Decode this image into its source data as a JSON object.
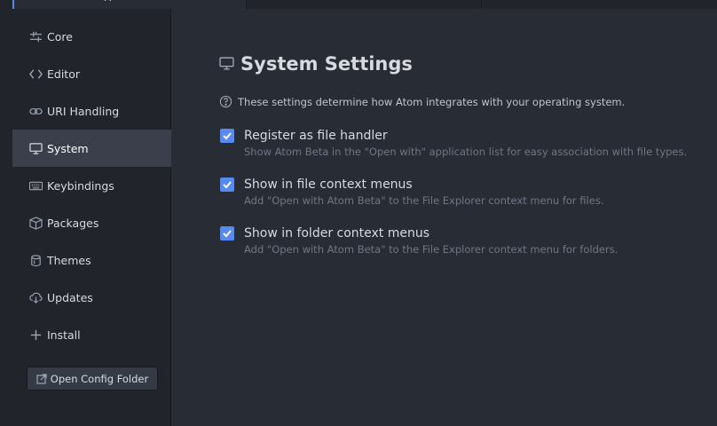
{
  "sidebar": {
    "items": [
      {
        "label": "Core",
        "icon": "sliders-icon"
      },
      {
        "label": "Editor",
        "icon": "code-icon"
      },
      {
        "label": "URI Handling",
        "icon": "link-icon"
      },
      {
        "label": "System",
        "icon": "monitor-icon",
        "selected": true
      },
      {
        "label": "Keybindings",
        "icon": "keyboard-icon"
      },
      {
        "label": "Packages",
        "icon": "package-icon"
      },
      {
        "label": "Themes",
        "icon": "paintcan-icon"
      },
      {
        "label": "Updates",
        "icon": "cloud-download-icon"
      },
      {
        "label": "Install",
        "icon": "plus-icon"
      }
    ],
    "config_button": "Open Config Folder"
  },
  "main": {
    "title": "System Settings",
    "description": "These settings determine how Atom integrates with your operating system.",
    "settings": [
      {
        "title": "Register as file handler",
        "description": "Show Atom Beta in the \"Open with\" application list for easy association with file types.",
        "checked": true
      },
      {
        "title": "Show in file context menus",
        "description": "Add \"Open with Atom Beta\" to the File Explorer context menu for files.",
        "checked": true
      },
      {
        "title": "Show in folder context menus",
        "description": "Add \"Open with Atom Beta\" to the File Explorer context menu for folders.",
        "checked": true
      }
    ]
  },
  "colors": {
    "accent": "#568af2",
    "background": "#282c34",
    "sidebar": "#21252b",
    "selected": "#3a3f4b"
  }
}
